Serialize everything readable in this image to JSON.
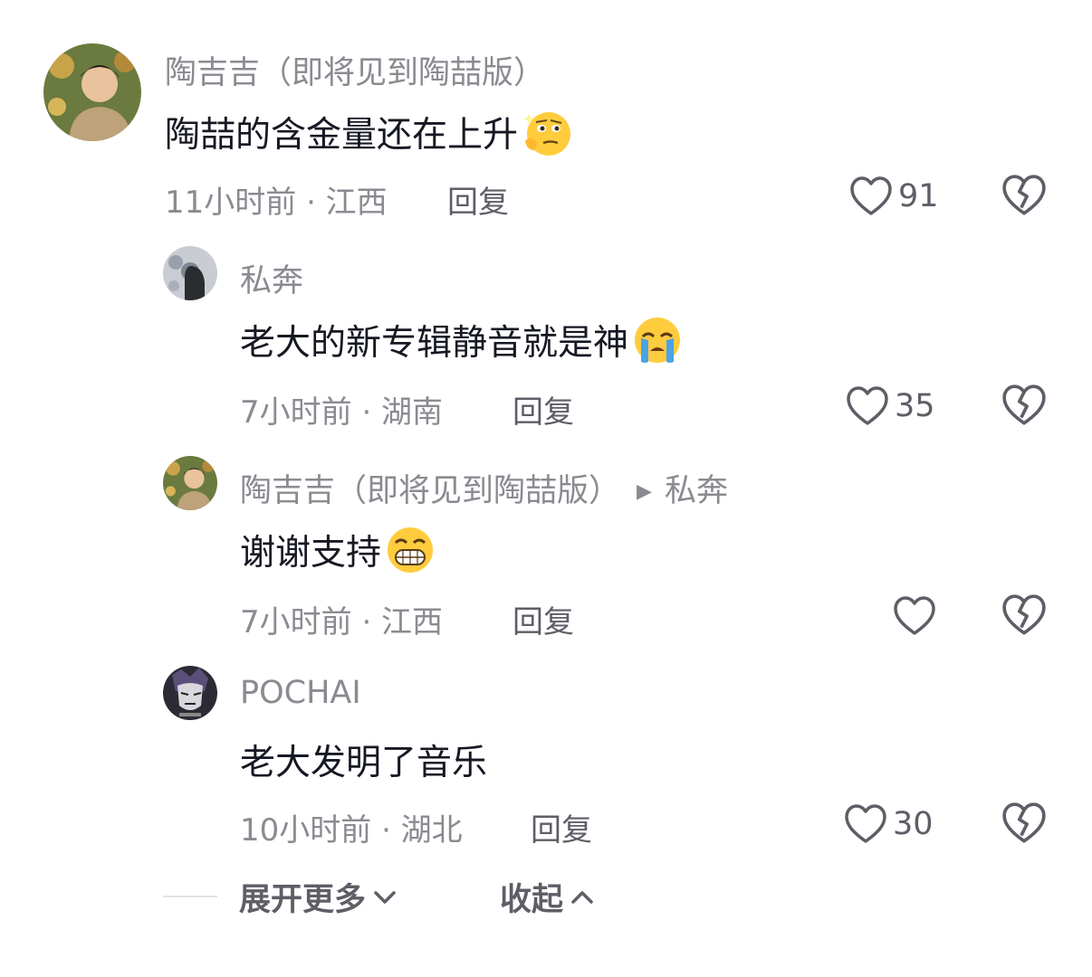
{
  "comments": [
    {
      "author": "陶吉吉（即将见到陶喆版）",
      "text": "陶喆的含金量还在上升",
      "emoji": "thinking-face-emoji",
      "time_location": "11小时前 · 江西",
      "reply_label": "回复",
      "likes": "91"
    },
    {
      "author": "私奔",
      "text": "老大的新专辑静音就是神",
      "emoji": "loudly-crying-face-emoji",
      "time_location": "7小时前 · 湖南",
      "reply_label": "回复",
      "likes": "35"
    },
    {
      "author": "陶吉吉（即将见到陶喆版）",
      "reply_to": "私奔",
      "text": "谢谢支持",
      "emoji": "grinning-squinting-face-emoji",
      "time_location": "7小时前 · 江西",
      "reply_label": "回复",
      "likes": ""
    },
    {
      "author": "POCHAI",
      "text": "老大发明了音乐",
      "time_location": "10小时前 · 湖北",
      "reply_label": "回复",
      "likes": "30"
    }
  ],
  "footer": {
    "expand_label": "展开更多",
    "collapse_label": "收起"
  },
  "colors": {
    "secondary_text": "#8a8b91",
    "primary_text": "#161823",
    "icon": "#5d5e66"
  }
}
